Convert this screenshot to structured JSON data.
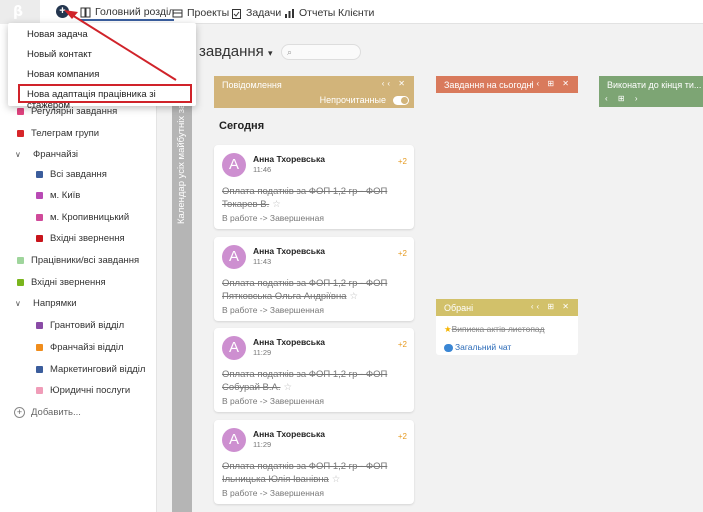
{
  "topbar": {
    "logo": "β",
    "plus": "+",
    "nav": [
      {
        "label": "Головний розділ"
      },
      {
        "label": "Проекты"
      },
      {
        "label": "Задачи"
      },
      {
        "label": "Отчеты"
      },
      {
        "label": "Клієнти"
      }
    ]
  },
  "dropdown": {
    "items": [
      {
        "label": "Новая задача"
      },
      {
        "label": "Новый контакт"
      },
      {
        "label": "Новая компания"
      },
      {
        "label": "Нова адаптація працівника зі стажером"
      }
    ]
  },
  "sidebar": {
    "items": [
      {
        "label": "Регулярні завдання",
        "color": "#e0437e"
      },
      {
        "label": "Телеграм групи",
        "color": "#d7262a"
      },
      {
        "label": "Франчайзі"
      },
      {
        "label": "Всі завдання",
        "color": "#3b5d9c"
      },
      {
        "label": "м. Київ",
        "color": "#b94ab5"
      },
      {
        "label": "м. Кропивницький",
        "color": "#d04a9a"
      },
      {
        "label": "Вхідні звернення",
        "color": "#c8141b"
      },
      {
        "label": "Працівники/всі завдання",
        "color": "#9fd59c"
      },
      {
        "label": "Вхідні звернення",
        "color": "#7ab51d"
      },
      {
        "label": "Напрямки"
      },
      {
        "label": "Грантовий відділ",
        "color": "#8a4ba6"
      },
      {
        "label": "Франчайзі відділ",
        "color": "#f08d1c"
      },
      {
        "label": "Маркетинговий відділ",
        "color": "#3b5d9c"
      },
      {
        "label": "Юридичні послуги",
        "color": "#f09cb8"
      }
    ],
    "add_label": "Добавить..."
  },
  "main": {
    "title": "завдання",
    "calendar_strip": "Календар усіх майбутніх завдань",
    "today_label": "Сегодня",
    "columns": [
      {
        "title": "Повідомлення",
        "color": "#d2b47a"
      },
      {
        "title": "Завдання на сьогодні",
        "color": "#d97a5c"
      },
      {
        "title": "Виконати до кінця ти...",
        "color": "#7da574"
      },
      {
        "title": "Обрані",
        "color": "#d2c16a"
      }
    ],
    "unread_label": "Непрочитанные",
    "cards": [
      {
        "initial": "А",
        "name": "Анна Тхоревська",
        "time": "11:46",
        "badge": "+2",
        "text": "Оплата податків за ФОП 1,2 гр - ФОП Токарев В.",
        "status": "В работе -> Завершенная"
      },
      {
        "initial": "А",
        "name": "Анна Тхоревська",
        "time": "11:43",
        "badge": "+2",
        "text": "Оплата податків за ФОП 1,2 гр - ФОП Пятковська Ольга Андріївна",
        "status": "В работе -> Завершенная"
      },
      {
        "initial": "А",
        "name": "Анна Тхоревська",
        "time": "11:29",
        "badge": "+2",
        "text": "Оплата податків за ФОП 1,2 гр - ФОП Собурай В.А.",
        "status": "В работе -> Завершенная"
      },
      {
        "initial": "А",
        "name": "Анна Тхоревська",
        "time": "11:29",
        "badge": "+2",
        "text": "Оплата податків за ФОП 1,2 гр - ФОП Ільницька Юлія Іванівна",
        "status": "В работе -> Завершенная"
      }
    ],
    "favorites": [
      {
        "label": "Виписка актів листопад",
        "icon": "star-icon"
      },
      {
        "label": "Загальний чат",
        "icon": "chat-icon"
      }
    ]
  }
}
